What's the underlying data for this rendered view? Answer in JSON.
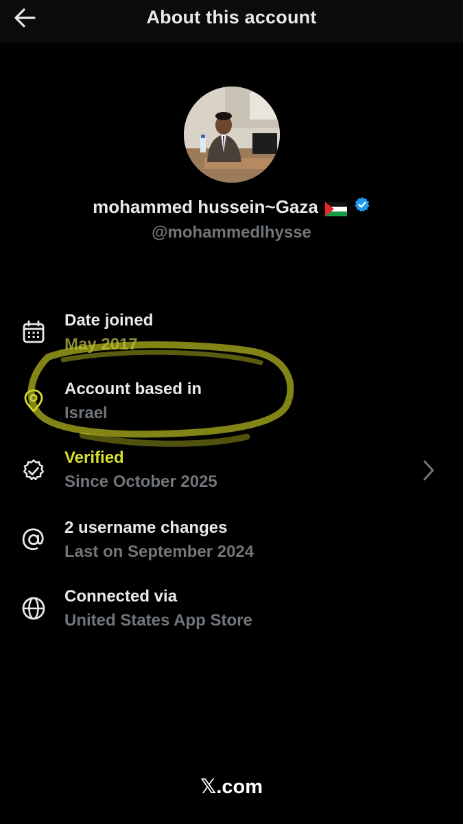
{
  "header": {
    "title": "About this account",
    "back_icon": "arrow-left-icon"
  },
  "profile": {
    "display_name": "mohammed hussein~Gaza",
    "flag": "palestine-flag",
    "verified_badge": "verified-badge-icon",
    "handle": "@mohammedlhysse"
  },
  "rows": [
    {
      "icon": "calendar-icon",
      "label": "Date joined",
      "value": "May 2017"
    },
    {
      "icon": "location-pin-icon",
      "label": "Account based in",
      "value": "Israel"
    },
    {
      "icon": "verified-icon",
      "label": "Verified",
      "value": "Since October 2025"
    },
    {
      "icon": "at-sign-icon",
      "label": "2 username changes",
      "value": "Last on September 2024"
    },
    {
      "icon": "globe-icon",
      "label": "Connected via",
      "value": "United States App Store"
    }
  ],
  "footer": {
    "logo": "𝕏",
    "text": ".com"
  },
  "colors": {
    "background": "#000000",
    "text": "#e7e9ea",
    "secondary_text": "#71767b",
    "highlight": "#d7e02a",
    "verified_blue": "#1d9bf0"
  }
}
